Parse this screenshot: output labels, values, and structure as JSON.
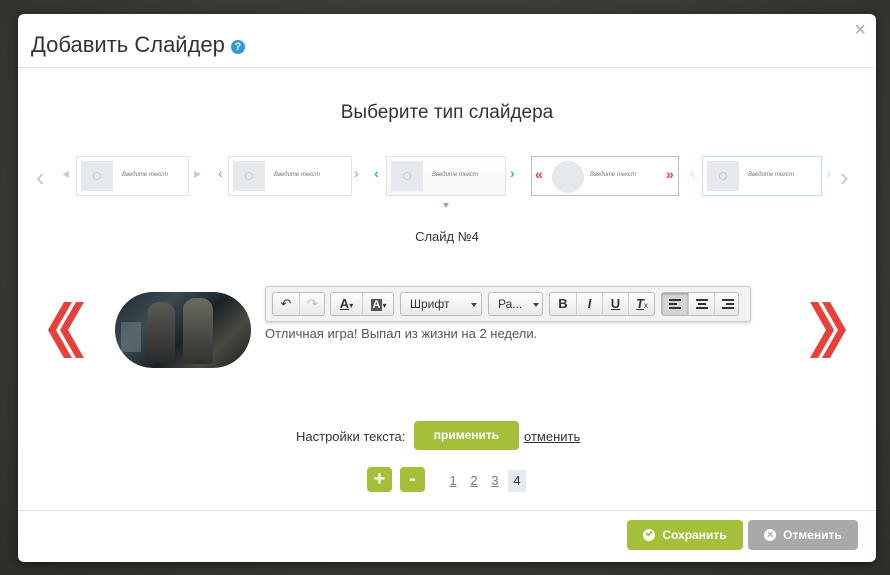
{
  "modal": {
    "title": "Добавить Слайдер",
    "help_icon": "?",
    "close_icon": "×"
  },
  "slider_types": {
    "title": "Выберите тип слайдера",
    "thumb_text": "Введите текст",
    "selected_label": "Слайд №4",
    "accent_colors": {
      "gray": "#cccccc",
      "teal": "#29b6d6",
      "red": "#e8413b",
      "light_teal": "#bfe3e6"
    }
  },
  "editor": {
    "font_select": "Шрифт",
    "size_select": "Ра...",
    "buttons": {
      "undo": "↶",
      "redo": "↷",
      "text_color": "A",
      "bg_color": "A",
      "bold": "B",
      "italic": "I",
      "underline": "U",
      "clear_format": "T"
    },
    "slide_text": "Отличная игра! Выпал из жизни на 2 недели."
  },
  "text_settings": {
    "label": "Настройки текста:",
    "apply": "применить",
    "cancel": "отменить"
  },
  "slides": {
    "add": "+",
    "remove": "-",
    "pages": [
      "1",
      "2",
      "3",
      "4"
    ],
    "current_page": "4"
  },
  "footer": {
    "save": "Сохранить",
    "cancel": "Отменить"
  }
}
